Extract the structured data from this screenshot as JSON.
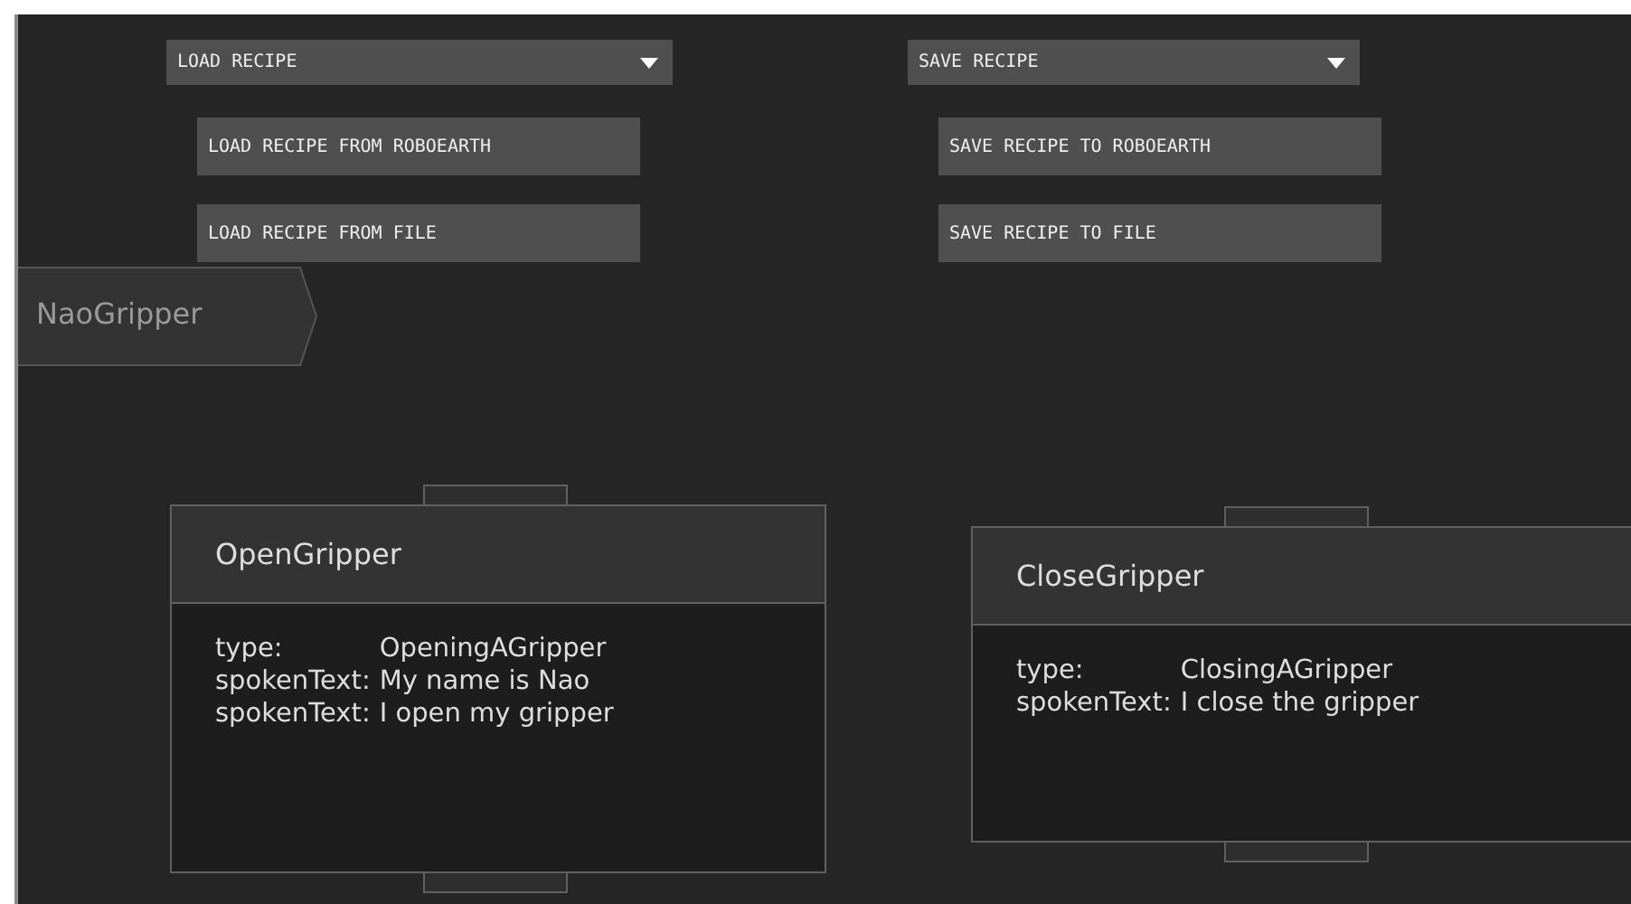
{
  "menus": [
    {
      "label": "LOAD RECIPE",
      "actions": [
        "LOAD RECIPE FROM ROBOEARTH",
        "LOAD RECIPE FROM FILE"
      ]
    },
    {
      "label": "SAVE RECIPE",
      "actions": [
        "SAVE RECIPE TO ROBOEARTH",
        "SAVE RECIPE TO FILE"
      ]
    }
  ],
  "breadcrumb": "NaoGripper",
  "nodes": [
    {
      "title": "OpenGripper",
      "properties": [
        {
          "key": "type:",
          "value": "OpeningAGripper"
        },
        {
          "key": "spokenText:",
          "value": "My name is Nao"
        },
        {
          "key": "spokenText:",
          "value": "I open my gripper"
        }
      ]
    },
    {
      "title": "CloseGripper",
      "properties": [
        {
          "key": "type:",
          "value": "ClosingAGripper"
        },
        {
          "key": "spokenText:",
          "value": "I close the gripper"
        }
      ]
    }
  ]
}
